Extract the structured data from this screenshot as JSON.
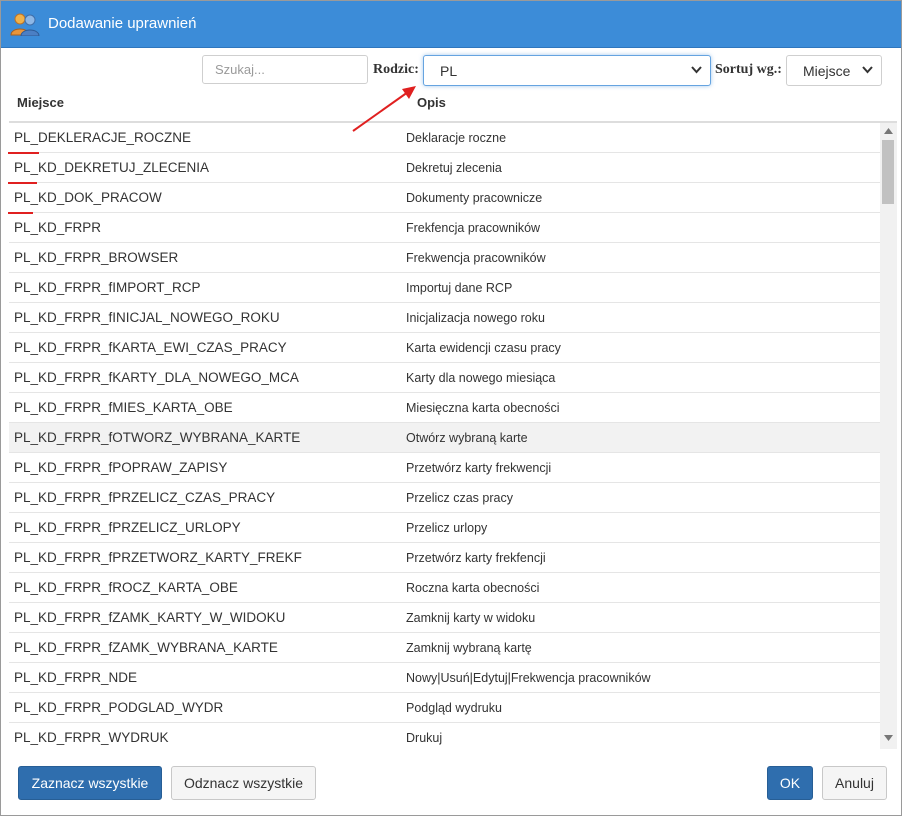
{
  "window": {
    "title": "Dodawanie uprawnień"
  },
  "toolbar": {
    "search_placeholder": "Szukaj...",
    "parent_label": "Rodzic:",
    "parent_value": "PL",
    "sort_label": "Sortuj wg.:",
    "sort_value": "Miejsce"
  },
  "table": {
    "headers": [
      "Miejsce",
      "Opis"
    ],
    "rows": [
      {
        "place": "PL_DEKLERACJE_ROCZNE",
        "desc": "Deklaracje roczne"
      },
      {
        "place": "PL_KD_DEKRETUJ_ZLECENIA",
        "desc": "Dekretuj zlecenia"
      },
      {
        "place": "PL_KD_DOK_PRACOW",
        "desc": "Dokumenty pracownicze"
      },
      {
        "place": "PL_KD_FRPR",
        "desc": "Frekfencja pracowników"
      },
      {
        "place": "PL_KD_FRPR_BROWSER",
        "desc": "Frekwencja pracowników"
      },
      {
        "place": "PL_KD_FRPR_fIMPORT_RCP",
        "desc": "Importuj dane RCP"
      },
      {
        "place": "PL_KD_FRPR_fINICJAL_NOWEGO_ROKU",
        "desc": "Inicjalizacja nowego roku"
      },
      {
        "place": "PL_KD_FRPR_fKARTA_EWI_CZAS_PRACY",
        "desc": "Karta ewidencji czasu pracy"
      },
      {
        "place": "PL_KD_FRPR_fKARTY_DLA_NOWEGO_MCA",
        "desc": "Karty dla nowego miesiąca"
      },
      {
        "place": "PL_KD_FRPR_fMIES_KARTA_OBE",
        "desc": "Miesięczna karta obecności"
      },
      {
        "place": "PL_KD_FRPR_fOTWORZ_WYBRANA_KARTE",
        "desc": "Otwórz wybraną karte"
      },
      {
        "place": "PL_KD_FRPR_fPOPRAW_ZAPISY",
        "desc": "Przetwórz karty frekwencji"
      },
      {
        "place": "PL_KD_FRPR_fPRZELICZ_CZAS_PRACY",
        "desc": "Przelicz czas pracy"
      },
      {
        "place": "PL_KD_FRPR_fPRZELICZ_URLOPY",
        "desc": "Przelicz urlopy"
      },
      {
        "place": "PL_KD_FRPR_fPRZETWORZ_KARTY_FREKF",
        "desc": "Przetwórz karty frekfencji"
      },
      {
        "place": "PL_KD_FRPR_fROCZ_KARTA_OBE",
        "desc": "Roczna karta obecności"
      },
      {
        "place": "PL_KD_FRPR_fZAMK_KARTY_W_WIDOKU",
        "desc": "Zamknij karty w widoku"
      },
      {
        "place": "PL_KD_FRPR_fZAMK_WYBRANA_KARTE",
        "desc": "Zamknij wybraną kartę"
      },
      {
        "place": "PL_KD_FRPR_NDE",
        "desc": "Nowy|Usuń|Edytuj|Frekwencja pracowników"
      },
      {
        "place": "PL_KD_FRPR_PODGLAD_WYDR",
        "desc": "Podgląd wydruku"
      },
      {
        "place": "PL_KD_FRPR_WYDRUK",
        "desc": "Drukuj"
      }
    ]
  },
  "footer": {
    "select_all": "Zaznacz wszystkie",
    "deselect_all": "Odznacz wszystkie",
    "ok": "OK",
    "cancel": "Anuluj"
  },
  "colors": {
    "titlebar": "#3c8cd8",
    "primary_button": "#2f6eae",
    "annotation": "#e02020"
  },
  "icons": {
    "title": "users-icon",
    "select": "chevron-down-icon"
  }
}
